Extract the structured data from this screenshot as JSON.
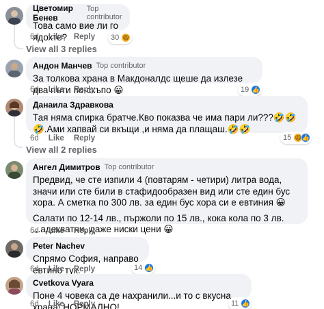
{
  "colors": {
    "bubble": "#f0f2f5",
    "muted": "#65676b",
    "like_blue": "#1877f2",
    "haha_yellow": "#f7b125"
  },
  "comments": [
    {
      "author": "Цветомир Бенев",
      "badge": "Top contributor",
      "text": [
        "Това само вие ли го ядохте?"
      ],
      "time": "6d",
      "like": "Like",
      "reply": "Reply",
      "reaction_count": "30",
      "reactions": [
        "haha-icon"
      ],
      "view_replies": "View all 3 replies"
    },
    {
      "author": "Андон Манчев",
      "badge": "Top contributor",
      "text": [
        "За толкова храна в Макдоналдс щеше да излезе два пъти по-скъпо 😀"
      ],
      "time": "6d",
      "like": "Like",
      "reply": "Reply",
      "reaction_count": "19",
      "reactions": [
        "like-icon"
      ]
    },
    {
      "author": "Данаила Здравкова",
      "badge": "",
      "text": [
        "Тая няма спирка братче.Кво показва че има пари ли???🤣🤣🤣.Ами хапвай си вкъщи ,и няма да плащаш.🤣🤣"
      ],
      "time": "6d",
      "like": "Like",
      "reply": "Reply",
      "reaction_count": "15",
      "reactions": [
        "haha-icon",
        "like-icon"
      ],
      "view_replies": "View all 2 replies"
    },
    {
      "author": "Ангел Димитров",
      "badge": "Top contributor",
      "text": [
        "Предвид, че сте изпили 4 (повтарям - четири) литра вода, значи или сте били в стафидообразен вид или сте един бус хора. А сметка по 300 лв. за един бус хора си е евтиния 😀",
        "Салати по 12-14 лв., пържоли по 15 лв., кока кола по 3 лв. ...адекватни, даже ниски цени 😀"
      ],
      "time": "6d",
      "like": "Like",
      "reply": "Reply",
      "reaction_count": "",
      "reactions": []
    },
    {
      "author": "Peter Nachev",
      "badge": "",
      "text": [
        "Спрямо София, направо евтино тук."
      ],
      "time": "6d",
      "like": "Like",
      "reply": "Reply",
      "reaction_count": "14",
      "reactions": [
        "like-icon"
      ]
    },
    {
      "author": "Cvetkova Vyara",
      "badge": "",
      "text": [
        "Поне 4 човека са де нахранили...и то с вкусна храна! НОРМАЛНО!"
      ],
      "time": "6d",
      "like": "Like",
      "reply": "Reply",
      "reaction_count": "11",
      "reactions": [
        "like-icon"
      ]
    }
  ]
}
